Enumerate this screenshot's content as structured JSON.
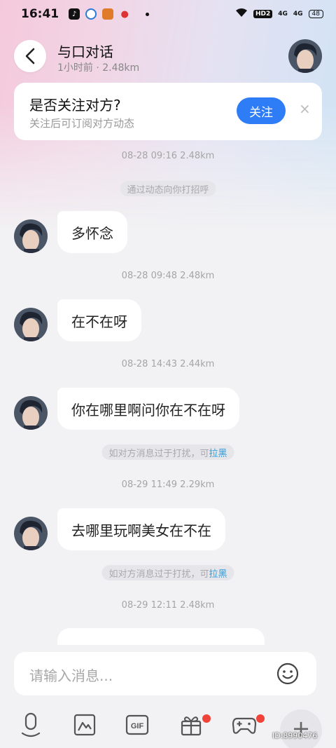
{
  "status_bar": {
    "time": "16:41",
    "wifi_label": "WiFi",
    "hd_label": "HD2",
    "signal1": "4G",
    "signal2": "4G",
    "battery": "48"
  },
  "header": {
    "name": "与口对话",
    "meta": "1小时前 · 2.48km",
    "back_icon": "back-arrow-icon"
  },
  "follow_card": {
    "title": "是否关注对方?",
    "subtitle": "关注后可订阅对方动态",
    "button_label": "关注",
    "close_label": "×"
  },
  "chat": {
    "timestamps": [
      "08-28 09:16  2.48km",
      "08-28 09:48  2.48km",
      "08-28 14:43  2.44km",
      "08-29 11:49  2.29km",
      "08-29 12:11  2.48km"
    ],
    "system_first": "通过动态向你打招呼",
    "system_spam_text": "如对方消息过于打扰，可",
    "system_spam_link": "拉黑",
    "messages": [
      "多怀念",
      "在不在呀",
      "你在哪里啊问你在不在呀",
      "去哪里玩啊美女在不在"
    ]
  },
  "input": {
    "placeholder": "请输入消息..."
  },
  "toolbar": {
    "items": [
      "voice-icon",
      "image-icon",
      "gif-icon",
      "gift-icon",
      "game-icon",
      "plus-icon"
    ],
    "gif_label": "GIF",
    "plus_label": "+"
  },
  "watermark": "ID:8990476"
}
